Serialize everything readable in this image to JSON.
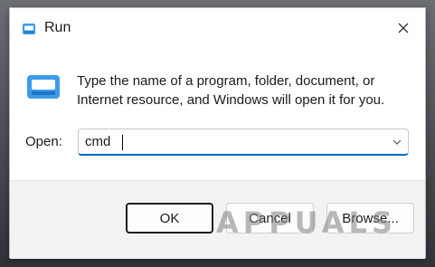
{
  "window": {
    "title": "Run"
  },
  "dialog": {
    "description": "Type the name of a program, folder, document, or Internet resource, and Windows will open it for you.",
    "open_label": "Open:",
    "open_value": "cmd"
  },
  "buttons": {
    "ok": "OK",
    "cancel": "Cancel",
    "browse": "Browse..."
  },
  "watermark": {
    "text": "APPUALS"
  },
  "colors": {
    "accent": "#0067c0",
    "footer_bg": "#f3f3f3"
  },
  "icons": {
    "title": "run-app-icon",
    "main": "run-app-icon",
    "close": "close-icon",
    "dropdown": "chevron-down-icon"
  }
}
